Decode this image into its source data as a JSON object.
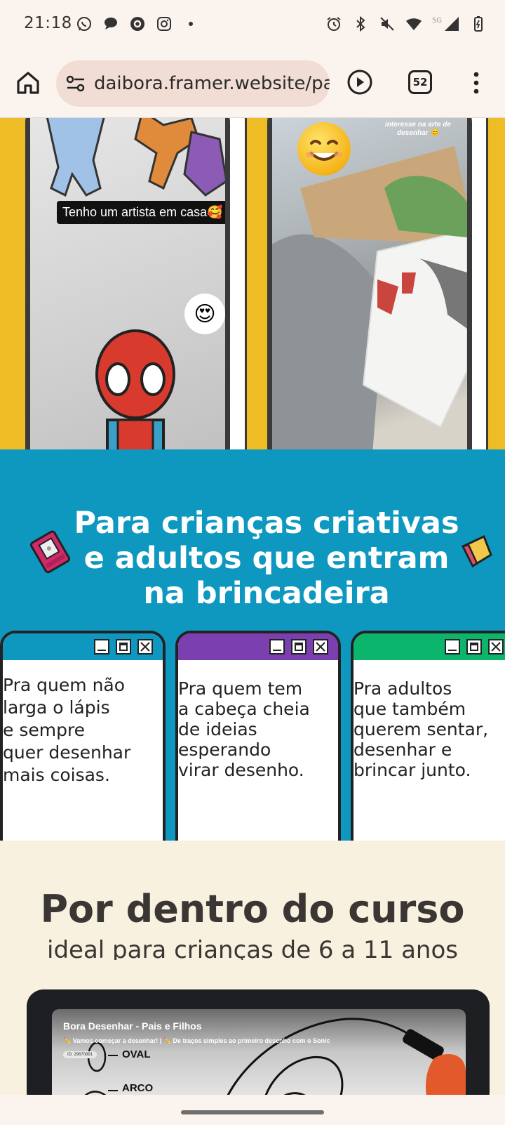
{
  "status_bar": {
    "time": "21:18",
    "network": "5G"
  },
  "browser": {
    "url": "daibora.framer.website/pai",
    "tab_count": "52"
  },
  "gallery": {
    "card1_caption": "Tenho um artista em casa🥰",
    "card1_reaction": "😍",
    "card2_caption": "E tem demonstrado muito interesse na arte de desenhar 😊",
    "card2_emoji": "😊"
  },
  "audience": {
    "headline_line1": "Para crianças criativas",
    "headline_line2": "e adultos que entram",
    "headline_line3": "na brincadeira",
    "cards": [
      {
        "text_lines": [
          "Pra quem não",
          "larga o lápis",
          "e sempre",
          "quer desenhar",
          "mais coisas."
        ],
        "color": "#0e98c0"
      },
      {
        "text_lines": [
          "Pra quem tem",
          "a cabeça cheia",
          "de ideias",
          "esperando",
          "virar desenho."
        ],
        "color": "#7b3fb0"
      },
      {
        "text_lines": [
          "Pra adultos",
          "que também",
          "querem sentar,",
          "desenhar e",
          "brincar junto."
        ],
        "color": "#0bb56b"
      }
    ]
  },
  "course": {
    "title": "Por dentro do curso",
    "subtitle": "ideal para crianças de 6 a 11 anos",
    "video_title": "Bora Desenhar - Pais e Filhos",
    "video_subtitle": "✏️ Vamos começar a desenhar! | ✏️ De traços simples ao primeiro desenho com o Sonic",
    "video_id": "ID: 29670891",
    "video_label_oval": "OVAL",
    "video_label_arco": "ARCO"
  },
  "colors": {
    "yellow": "#eebd25",
    "blue": "#0e98c0",
    "cream": "#f8f1df"
  }
}
